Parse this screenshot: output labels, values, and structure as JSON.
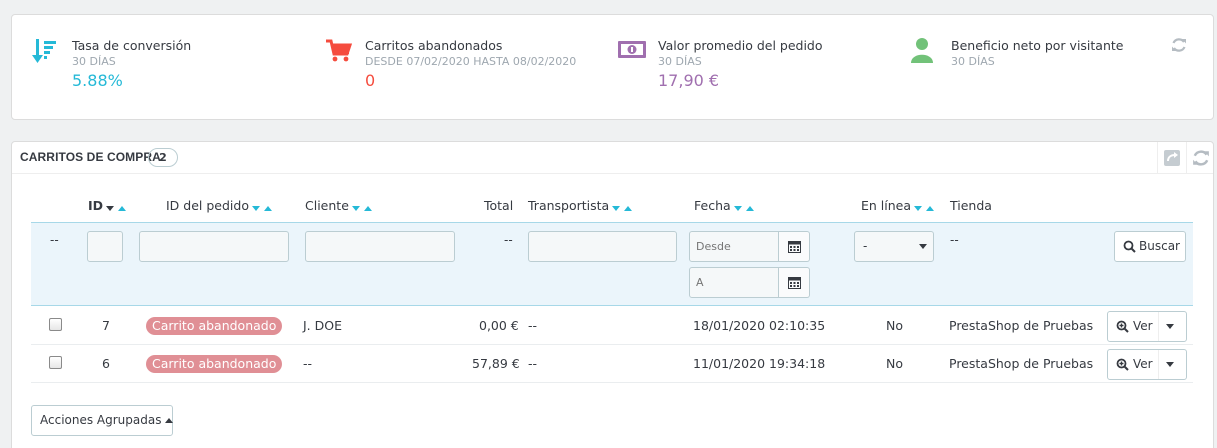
{
  "kpis": [
    {
      "icon": "sort-amount-down-icon",
      "title": "Tasa de conversión",
      "subtitle": "30 DÍAS",
      "value": "5.88%",
      "color": "#25b9d7"
    },
    {
      "icon": "shopping-cart-icon",
      "title": "Carritos abandonados",
      "subtitle": "DESDE 07/02/2020 HASTA 08/02/2020",
      "value": "0",
      "color": "#f54c3e"
    },
    {
      "icon": "money-bill-icon",
      "title": "Valor promedio del pedido",
      "subtitle": "30 DÍAS",
      "value": "17,90 €",
      "color": "#a06faf"
    },
    {
      "icon": "user-icon",
      "title": "Beneficio neto por visitante",
      "subtitle": "30 DÍAS",
      "value": "",
      "color": "#72c279"
    }
  ],
  "carts": {
    "title": "CARRITOS DE COMPRA",
    "count": "2",
    "columns": {
      "id": "ID",
      "order_id": "ID del pedido",
      "customer": "Cliente",
      "total": "Total",
      "carrier": "Transportista",
      "date": "Fecha",
      "online": "En línea",
      "shop": "Tienda"
    },
    "filters": {
      "dash": "--",
      "date_from_placeholder": "Desde",
      "date_to_placeholder": "A",
      "online_selected": "-",
      "search_label": "Buscar"
    },
    "rows": [
      {
        "id": "7",
        "order": "Carrito abandonado",
        "customer": "J. DOE",
        "total": "0,00 €",
        "carrier": "--",
        "date": "18/01/2020 02:10:35",
        "online": "No",
        "shop": "PrestaShop de Pruebas",
        "action": "Ver"
      },
      {
        "id": "6",
        "order": "Carrito abandonado",
        "customer": "--",
        "total": "57,89 €",
        "carrier": "--",
        "date": "11/01/2020 19:34:18",
        "online": "No",
        "shop": "PrestaShop de Pruebas",
        "action": "Ver"
      }
    ],
    "bulk_label": "Acciones Agrupadas"
  },
  "colors": {
    "accent": "#25b9d7",
    "badge": "#e08f95"
  }
}
